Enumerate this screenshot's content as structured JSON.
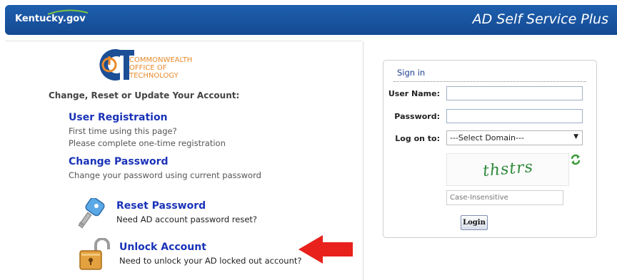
{
  "header": {
    "logo_text": "Kentucky.gov",
    "app_title": "AD Self Service Plus"
  },
  "branding": {
    "org_lines": [
      "COMMONWEALTH",
      "OFFICE OF",
      "TECHNOLOGY"
    ]
  },
  "left": {
    "tagline": "Change, Reset or Update Your Account:",
    "options": [
      {
        "title": "User Registration",
        "desc": [
          "First time using this page?",
          "Please complete one-time registration"
        ]
      },
      {
        "title": "Change Password",
        "desc": [
          "Change your password using current password"
        ]
      },
      {
        "title": "Reset Password",
        "desc": [
          "Need AD account password reset?"
        ],
        "icon": "key-icon"
      },
      {
        "title": "Unlock Account",
        "desc": [
          "Need to unlock your AD locked out account?"
        ],
        "icon": "padlock-icon"
      }
    ]
  },
  "signin": {
    "title": "Sign in",
    "username_label": "User Name:",
    "username_value": "",
    "password_label": "Password:",
    "password_value": "",
    "logon_label": "Log on to:",
    "domain_selected": "---Select Domain---",
    "captcha_text": "thstrs",
    "captcha_placeholder": "Case-Insensitive",
    "login_label": "Login"
  },
  "colors": {
    "header_blue": "#1a55a2",
    "link_blue": "#1a33b8",
    "arrow_red": "#e8211c",
    "captcha_green": "#2f8a3c",
    "org_orange": "#e98a2a"
  }
}
